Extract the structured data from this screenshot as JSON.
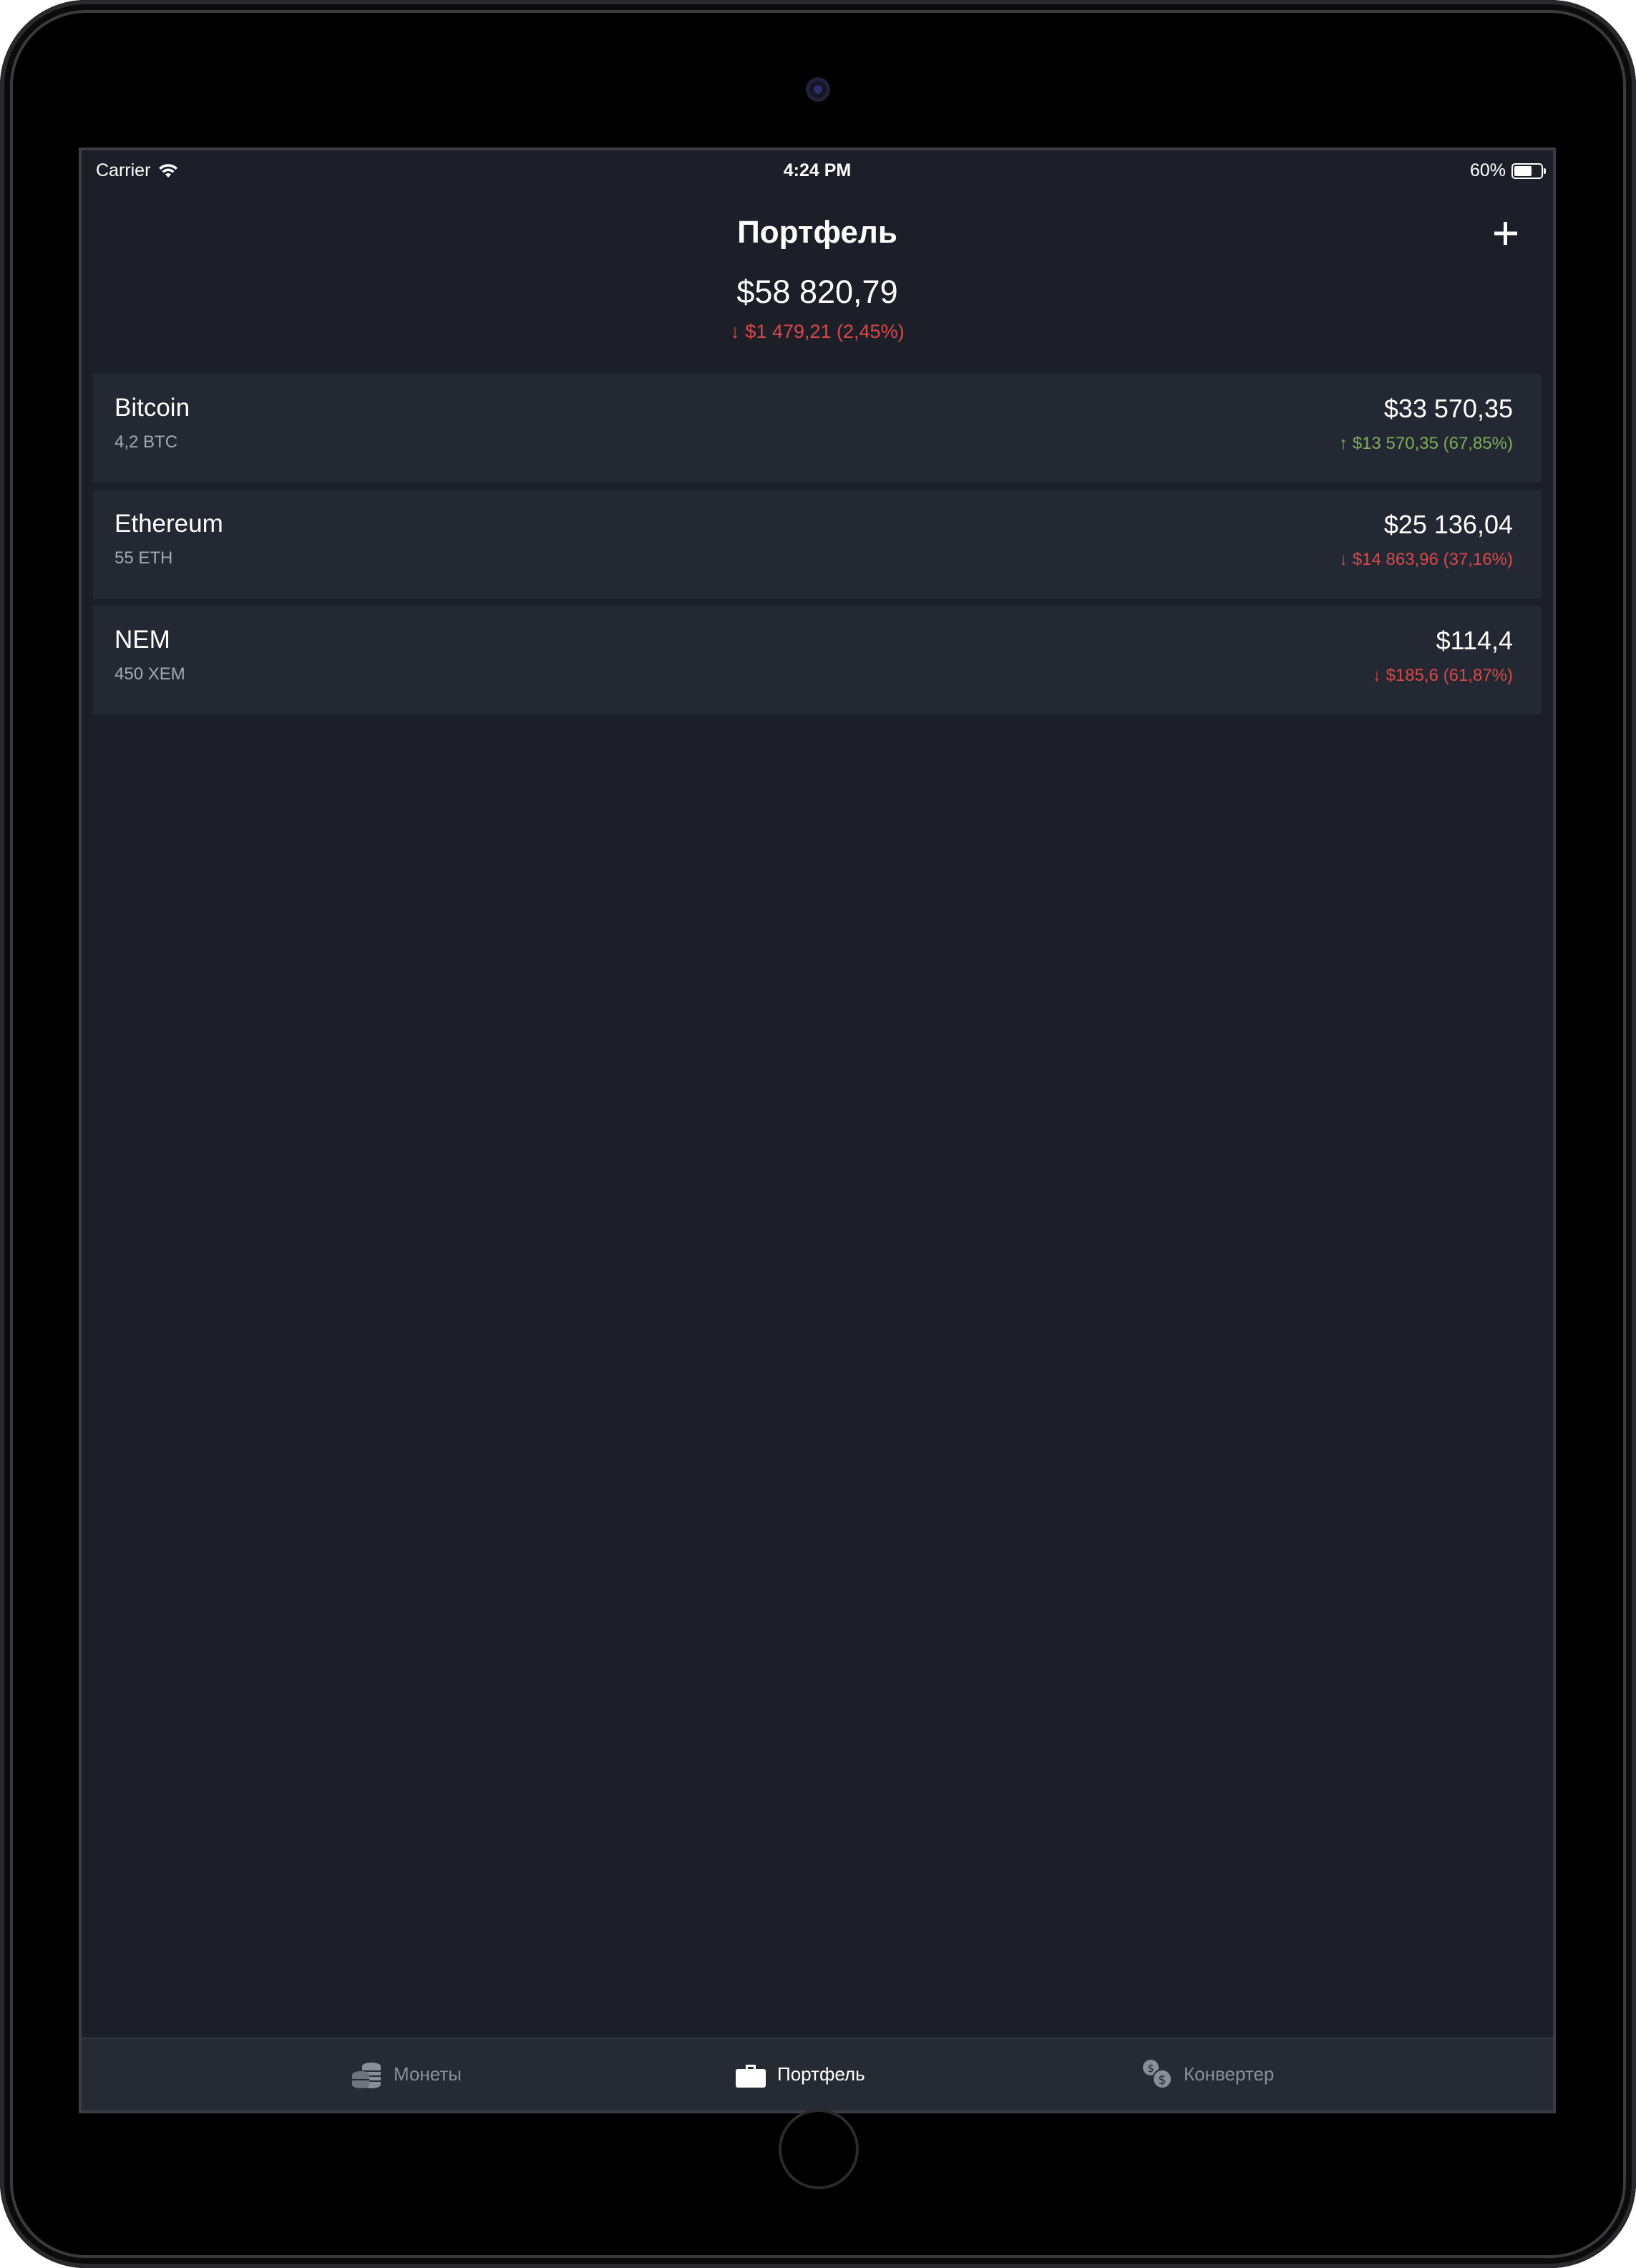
{
  "status_bar": {
    "carrier": "Carrier",
    "time": "4:24 PM",
    "battery": "60%"
  },
  "header": {
    "title": "Портфель",
    "add_icon": "plus-icon",
    "total_value": "$58 820,79",
    "total_change": "↓ $1 479,21 (2,45%)",
    "total_change_direction": "down"
  },
  "coins": [
    {
      "name": "Bitcoin",
      "amount": "4,2 BTC",
      "value": "$33 570,35",
      "change": "↑ $13 570,35 (67,85%)",
      "direction": "up"
    },
    {
      "name": "Ethereum",
      "amount": "55 ETH",
      "value": "$25 136,04",
      "change": "↓ $14 863,96 (37,16%)",
      "direction": "down"
    },
    {
      "name": "NEM",
      "amount": "450 XEM",
      "value": "$114,4",
      "change": "↓ $185,6 (61,87%)",
      "direction": "down"
    }
  ],
  "tab_bar": {
    "tabs": [
      {
        "label": "Монеты",
        "icon": "coins-icon",
        "active": false
      },
      {
        "label": "Портфель",
        "icon": "briefcase-icon",
        "active": true
      },
      {
        "label": "Конвертер",
        "icon": "converter-icon",
        "active": false
      }
    ]
  },
  "colors": {
    "background": "#1c1f28",
    "row_background": "#242833",
    "positive": "#7cae5a",
    "negative": "#d64a4a"
  }
}
